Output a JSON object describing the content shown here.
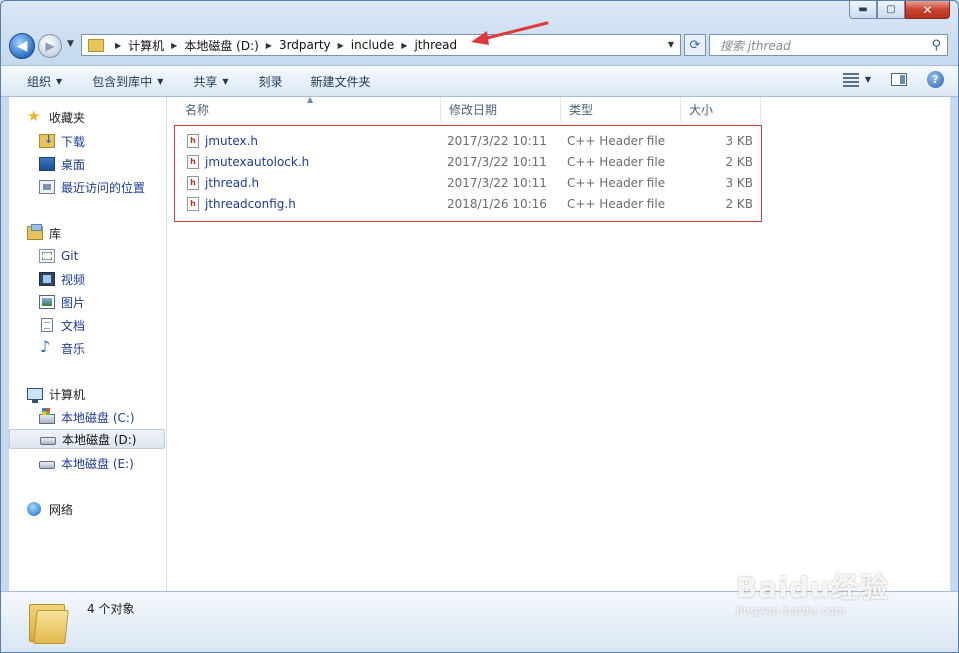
{
  "window": {
    "caption_buttons": {
      "minimize": "▬",
      "maximize": "▢",
      "close": "✕"
    }
  },
  "nav": {
    "back_glyph": "◀",
    "forward_glyph": "▶",
    "breadcrumbs": [
      "计算机",
      "本地磁盘 (D:)",
      "3rdparty",
      "include",
      "jthread"
    ],
    "separator": "▶",
    "refresh_glyph": "⟳",
    "search_placeholder": "搜索 jthread"
  },
  "toolbar": {
    "organize": "组织",
    "include_in_library": "包含到库中",
    "share": "共享",
    "burn": "刻录",
    "new_folder": "新建文件夹",
    "help": "?"
  },
  "sidebar": {
    "favorites": {
      "label": "收藏夹",
      "icon": "star-icon",
      "items": [
        {
          "label": "下载",
          "icon": "downloads-folder-icon"
        },
        {
          "label": "桌面",
          "icon": "desktop-icon"
        },
        {
          "label": "最近访问的位置",
          "icon": "recent-places-icon"
        }
      ]
    },
    "libraries": {
      "label": "库",
      "icon": "library-icon",
      "items": [
        {
          "label": "Git",
          "icon": "git-library-icon"
        },
        {
          "label": "视频",
          "icon": "video-icon"
        },
        {
          "label": "图片",
          "icon": "pictures-icon"
        },
        {
          "label": "文档",
          "icon": "documents-icon"
        },
        {
          "label": "音乐",
          "icon": "music-icon"
        }
      ]
    },
    "computer": {
      "label": "计算机",
      "icon": "computer-icon",
      "items": [
        {
          "label": "本地磁盘 (C:)",
          "icon": "system-drive-icon"
        },
        {
          "label": "本地磁盘 (D:)",
          "icon": "drive-icon",
          "selected": true
        },
        {
          "label": "本地磁盘 (E:)",
          "icon": "drive-icon"
        }
      ]
    },
    "network": {
      "label": "网络",
      "icon": "network-icon"
    }
  },
  "columns": {
    "name": "名称",
    "modified": "修改日期",
    "type": "类型",
    "size": "大小"
  },
  "files": [
    {
      "name": "jmutex.h",
      "modified": "2017/3/22 10:11",
      "type": "C++ Header file",
      "size": "3 KB",
      "icon_letter": "h"
    },
    {
      "name": "jmutexautolock.h",
      "modified": "2017/3/22 10:11",
      "type": "C++ Header file",
      "size": "2 KB",
      "icon_letter": "h"
    },
    {
      "name": "jthread.h",
      "modified": "2017/3/22 10:11",
      "type": "C++ Header file",
      "size": "3 KB",
      "icon_letter": "h"
    },
    {
      "name": "jthreadconfig.h",
      "modified": "2018/1/26 10:16",
      "type": "C++ Header file",
      "size": "2 KB",
      "icon_letter": "h"
    }
  ],
  "status": {
    "count_text": "4 个对象"
  },
  "watermark": {
    "logo": "Baidu经验",
    "url": "jingyan.baidu.com"
  },
  "colors": {
    "annotation_red": "#e0373d",
    "link_blue": "#1c3c9b"
  }
}
